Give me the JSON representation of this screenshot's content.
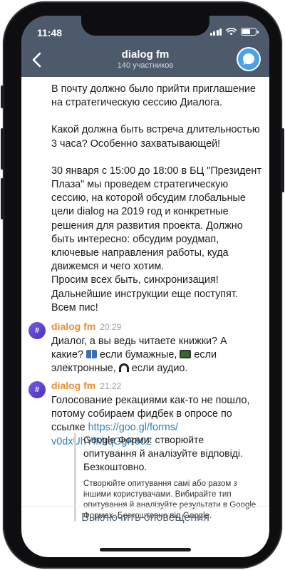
{
  "status_bar": {
    "time": "11:48"
  },
  "header": {
    "title": "dialog fm",
    "subtitle": "140 участников"
  },
  "message_continuation": {
    "lines": [
      "В почту должно было прийти приглашение",
      "на стратегическую сессию Диалога.",
      "",
      "Какой должна быть встреча длительностью",
      "3 часа? Особенно захватывающей!",
      "",
      "30 января с 15:00 до 18:00 в БЦ \"Президент",
      "Плаза\" мы проведем стратегическую",
      "сессию, на которой обсудим глобальные",
      "цели dialog на 2019 год и конкретные",
      "решения для развития проекта. Должно",
      "быть интересно: обсудим роудмап,",
      "ключевые направления работы, куда",
      "движемся и чего хотим.",
      "Просим всех быть, синхронизация!",
      "Дальнейшие инструкции еще поступят.",
      "Всем пис!"
    ]
  },
  "messages": [
    {
      "author": "dialog fm",
      "time": "20:29",
      "avatar_text": "#",
      "text_part1": "Диалог, а вы ведь читаете книжки? А",
      "text_part2": "какие? ",
      "text_part3": " если бумажные, ",
      "text_part4": " если",
      "text_part5": "электронные, ",
      "text_part6": " если аудио."
    },
    {
      "author": "dialog fm",
      "time": "21:22",
      "avatar_text": "#",
      "line1": "Голосование рекациями как-то не пошло,",
      "line2": "потому собираем фидбек в опросе по",
      "line3_prefix": "ссылке ",
      "link_part1": "https://goo.gl/forms/",
      "link_part2": "v0dxUhYfMrqGgR602"
    }
  ],
  "link_preview": {
    "title": "Google Форми: створюйте опитування й аналізуйте відповіді. Безкоштовно.",
    "description": "Створюйте опитування самі або разом з іншими користувачами. Вибирайте тип опитування й аналізуйте результати в Google Формах. Безкоштовно від Google."
  },
  "footer": {
    "action_label": "Выключить оповещения"
  },
  "colors": {
    "header_bg": "#4d5a6b",
    "author": "#ed8e2f",
    "link": "#2f7fc1",
    "avatar_gradient_start": "#7a58e8",
    "avatar_gradient_end": "#4634b5"
  }
}
